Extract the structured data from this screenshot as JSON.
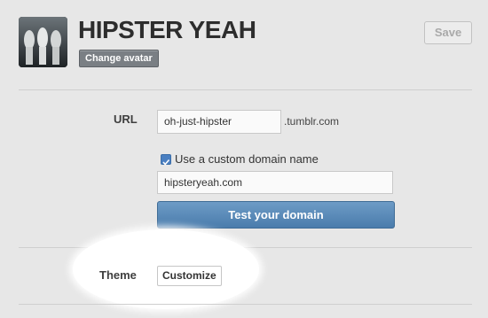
{
  "header": {
    "blog_title": "HIPSTER YEAH",
    "change_avatar_label": "Change avatar",
    "save_label": "Save"
  },
  "url": {
    "label": "URL",
    "subdomain_value": "oh-just-hipster",
    "suffix": ".tumblr.com"
  },
  "custom_domain": {
    "checkbox_checked": true,
    "checkbox_label": "Use a custom domain name",
    "domain_value": "hipsteryeah.com",
    "test_button_label": "Test your domain"
  },
  "theme": {
    "label": "Theme",
    "customize_label": "Customize"
  },
  "colors": {
    "page_bg": "#e7e7e7",
    "accent_blue": "#4a7cac",
    "spotlight": "#ffffff"
  }
}
